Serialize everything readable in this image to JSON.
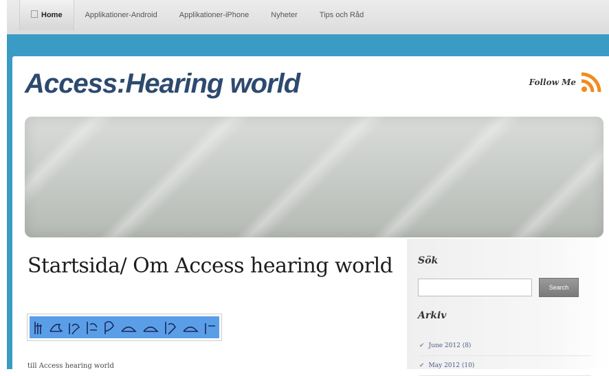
{
  "nav": {
    "items": [
      {
        "label": "Home",
        "active": true
      },
      {
        "label": "Applikationer-Android",
        "active": false
      },
      {
        "label": "Applikationer-iPhone",
        "active": false
      },
      {
        "label": "Nyheter",
        "active": false
      },
      {
        "label": "Tips och Råd",
        "active": false
      }
    ]
  },
  "header": {
    "site_title": "Access:Hearing world",
    "follow_label": "Follow Me",
    "follow_icon": "rss-icon"
  },
  "main": {
    "page_title": "Startsida/ Om Access hearing world",
    "intro_text": "till Access hearing world"
  },
  "sidebar": {
    "search_title": "Sök",
    "search_placeholder": "",
    "search_button": "Search",
    "archive_title": "Arkiv",
    "archive_items": [
      {
        "label": "June 2012 (8)"
      },
      {
        "label": "May 2012 (10)"
      }
    ]
  },
  "colors": {
    "band": "#3a9bc4",
    "title": "#2d4a6e",
    "rss": "#f28a1e"
  }
}
